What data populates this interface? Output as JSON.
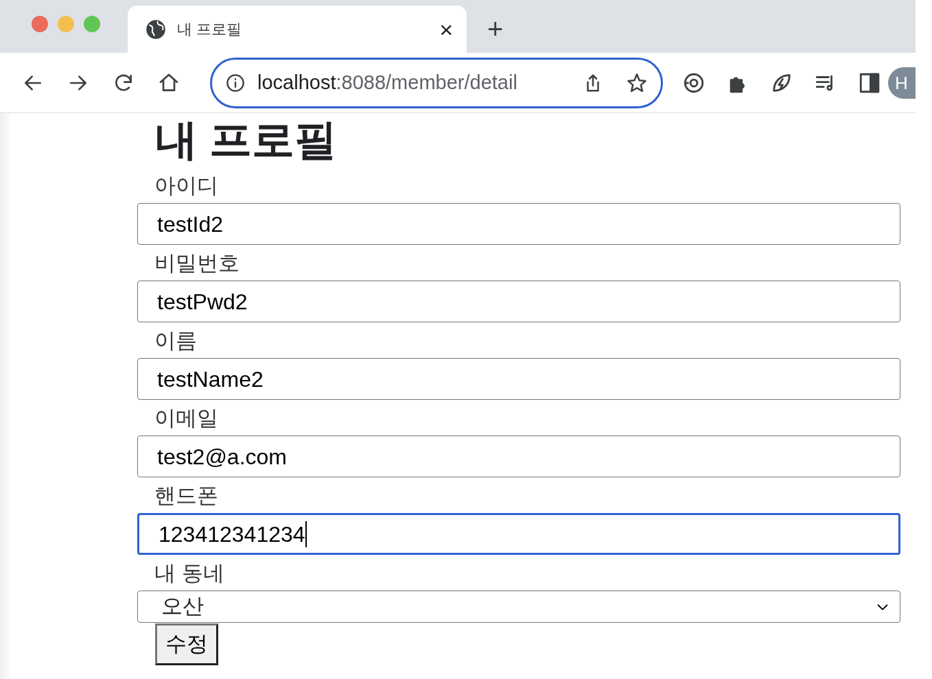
{
  "browser": {
    "tab": {
      "title": "내 프로필",
      "close": "×"
    },
    "new_tab": "+",
    "address": {
      "host": "localhost",
      "path": ":8088/member/detail",
      "focused": true
    },
    "profile": "H"
  },
  "page": {
    "heading": "내 프로필",
    "fields": [
      {
        "kind": "text",
        "label": "아이디",
        "value": "testId2",
        "focused": false
      },
      {
        "kind": "text",
        "label": "비밀번호",
        "value": "testPwd2",
        "focused": false
      },
      {
        "kind": "text",
        "label": "이름",
        "value": "testName2",
        "focused": false
      },
      {
        "kind": "text",
        "label": "이메일",
        "value": "test2@a.com",
        "focused": false
      },
      {
        "kind": "text",
        "label": "핸드폰",
        "value": "123412341234",
        "focused": true
      },
      {
        "kind": "select",
        "label": "내 동네",
        "value": "오산",
        "focused": false
      }
    ],
    "submit": "수정"
  }
}
